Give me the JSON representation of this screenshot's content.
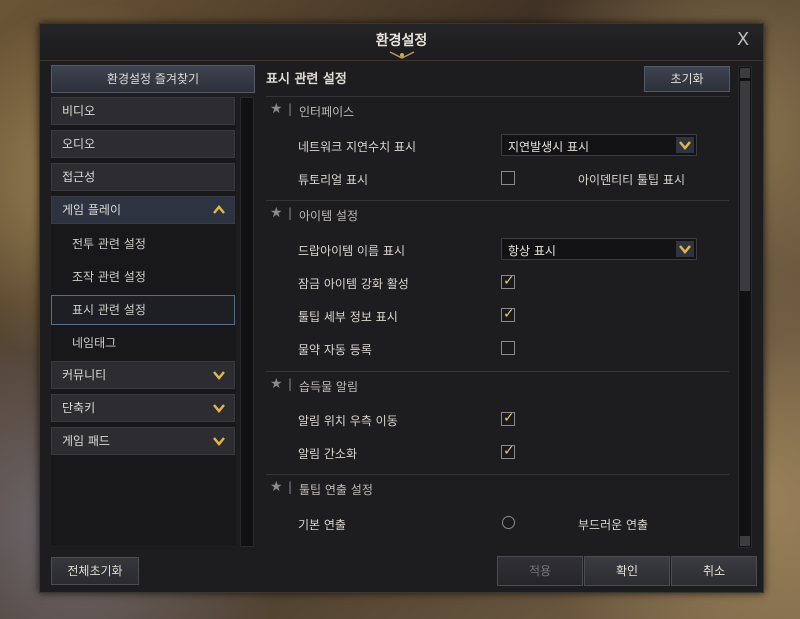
{
  "window": {
    "title": "환경설정",
    "close_glyph": "X"
  },
  "sidebar": {
    "favorites_label": "환경설정 즐겨찾기",
    "items": [
      {
        "label": "비디오"
      },
      {
        "label": "오디오"
      },
      {
        "label": "접근성"
      },
      {
        "label": "게임 플레이",
        "expanded": true
      },
      {
        "label": "커뮤니티",
        "expanded": false
      },
      {
        "label": "단축키",
        "expanded": false
      },
      {
        "label": "게임 패드",
        "expanded": false
      }
    ],
    "sub_items": [
      {
        "label": "전투 관련 설정"
      },
      {
        "label": "조작 관련 설정"
      },
      {
        "label": "표시 관련 설정",
        "selected": true
      },
      {
        "label": "네임태그"
      }
    ],
    "reset_all_label": "전체초기화"
  },
  "content": {
    "title": "표시 관련 설정",
    "reset_label": "초기화",
    "sections": [
      {
        "label": "인터페이스"
      },
      {
        "label": "아이템 설정"
      },
      {
        "label": "습득물 알림"
      },
      {
        "label": "툴팁 연출 설정"
      }
    ],
    "options": {
      "network_delay": {
        "label": "네트워크 지연수치 표시",
        "value": "지연발생시 표시"
      },
      "tutorial": {
        "label": "튜토리얼 표시",
        "checked": false
      },
      "identity_tooltip": {
        "label": "아이덴티티 툴팁 표시",
        "checked": true
      },
      "drop_item_name": {
        "label": "드랍아이템 이름 표시",
        "value": "항상 표시"
      },
      "locked_enhance": {
        "label": "잠금 아이템 강화 활성",
        "checked": true
      },
      "tooltip_detail": {
        "label": "툴팁 세부 정보 표시",
        "checked": true
      },
      "potion_auto": {
        "label": "물약 자동 등록",
        "checked": false
      },
      "notify_move_right": {
        "label": "알림 위치 우측 이동",
        "checked": true
      },
      "notify_simple": {
        "label": "알림 간소화",
        "checked": true
      },
      "tooltip_basic": {
        "label": "기본 연출",
        "selected": false
      },
      "tooltip_smooth": {
        "label": "부드러운 연출",
        "selected": true
      }
    }
  },
  "footer": {
    "apply_label": "적용",
    "confirm_label": "확인",
    "cancel_label": "취소"
  },
  "colors": {
    "check_mark": "#e7c56a",
    "accent_blue": "#2e3341"
  },
  "icons": {
    "check": "✓",
    "star": "★",
    "close": "close-icon"
  }
}
